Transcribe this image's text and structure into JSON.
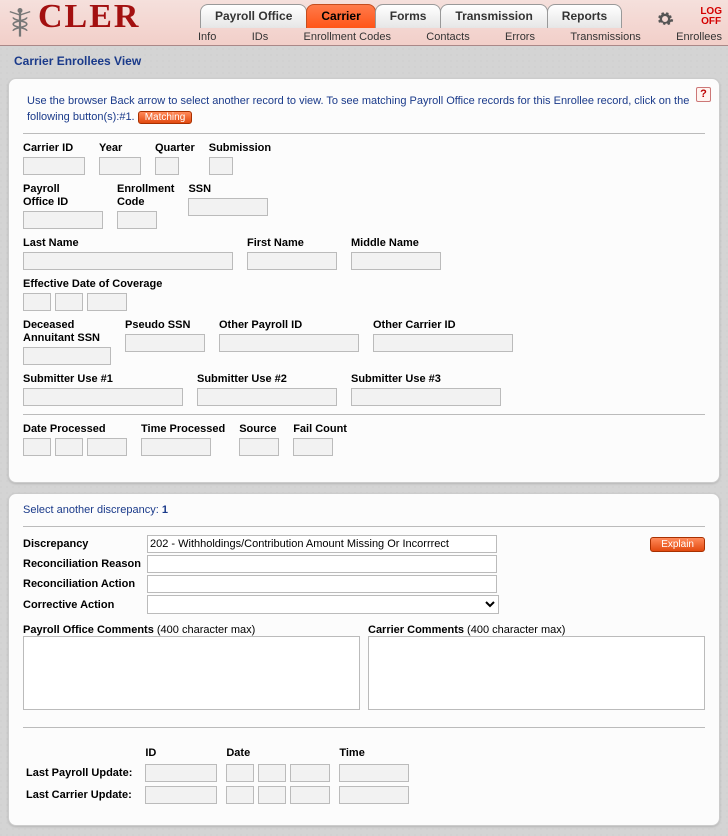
{
  "brand": "CLER",
  "tabs": [
    "Payroll Office",
    "Carrier",
    "Forms",
    "Transmission",
    "Reports"
  ],
  "active_tab": "Carrier",
  "logoff": "LOG\nOFF",
  "subnav": [
    "Info",
    "IDs",
    "Enrollment Codes",
    "Contacts",
    "Errors",
    "Transmissions",
    "Enrollees"
  ],
  "panel1": {
    "title": "Carrier Enrollees View",
    "instruction_a": "Use the browser Back arrow to select another record to view.   To see matching Payroll Office records for this Enrollee record, click on the following button(s):#1.",
    "matching_btn": "Matching",
    "help_tooltip": "Help",
    "labels": {
      "carrier_id": "Carrier ID",
      "year": "Year",
      "quarter": "Quarter",
      "submission": "Submission",
      "payroll_office_id": "Payroll\nOffice ID",
      "enrollment_code": "Enrollment\nCode",
      "ssn": "SSN",
      "last_name": "Last Name",
      "first_name": "First Name",
      "middle_name": "Middle Name",
      "eff_date": "Effective Date of Coverage",
      "dec_annuitant_ssn": "Deceased\nAnnuitant SSN",
      "pseudo_ssn": "Pseudo SSN",
      "other_payroll_id": "Other Payroll ID",
      "other_carrier_id": "Other Carrier ID",
      "sub1": "Submitter Use #1",
      "sub2": "Submitter Use #2",
      "sub3": "Submitter Use #3",
      "date_processed": "Date Processed",
      "time_processed": "Time Processed",
      "source": "Source",
      "fail_count": "Fail Count"
    }
  },
  "panel2": {
    "select_text": "Select another discrepancy:",
    "select_num": "1",
    "labels": {
      "discrepancy": "Discrepancy",
      "rec_reason": "Reconciliation Reason",
      "rec_action": "Reconciliation Action",
      "corrective": "Corrective Action",
      "po_comments_b": "Payroll Office Comments",
      "po_comments_n": " (400 character max)",
      "car_comments_b": "Carrier Comments",
      "car_comments_n": " (400 character max)",
      "id": "ID",
      "date": "Date",
      "time": "Time",
      "last_payroll": "Last Payroll Update:",
      "last_carrier": "Last Carrier Update:"
    },
    "discrepancy_value": "202 - Withholdings/Contribution Amount Missing Or Incorrrect",
    "explain_btn": "Explain"
  }
}
